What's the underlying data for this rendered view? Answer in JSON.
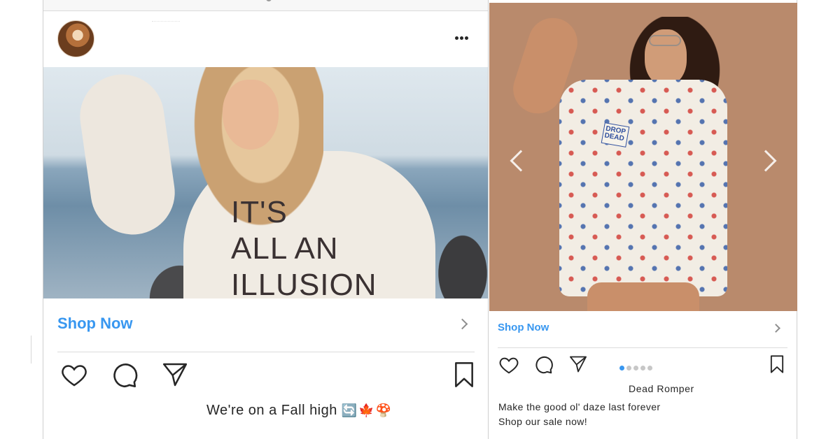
{
  "left_post": {
    "shop_now_label": "Shop Now",
    "caption_text": "We're on a Fall high",
    "caption_emojis": [
      "sync-emoji",
      "maple-leaf-emoji",
      "mushroom-emoji"
    ],
    "image_overlay_text": [
      "IT'S",
      "ALL AN",
      "ILLUSION"
    ]
  },
  "right_post": {
    "shop_now_label": "Shop Now",
    "product_name": "Dead Romper",
    "caption_line_1": "Make the good ol' daze last forever",
    "caption_line_2": "Shop our sale now!",
    "badge_text": "DROP DEAD",
    "carousel": {
      "total": 5,
      "active": 1
    }
  },
  "colors": {
    "link_blue": "#3897f0",
    "icon_dark": "#262626",
    "divider": "#dbdbdb"
  },
  "icons": [
    "more-options-icon",
    "heart-icon",
    "comment-icon",
    "share-icon",
    "bookmark-icon",
    "chevron-right-icon",
    "carousel-prev-icon",
    "carousel-next-icon"
  ]
}
